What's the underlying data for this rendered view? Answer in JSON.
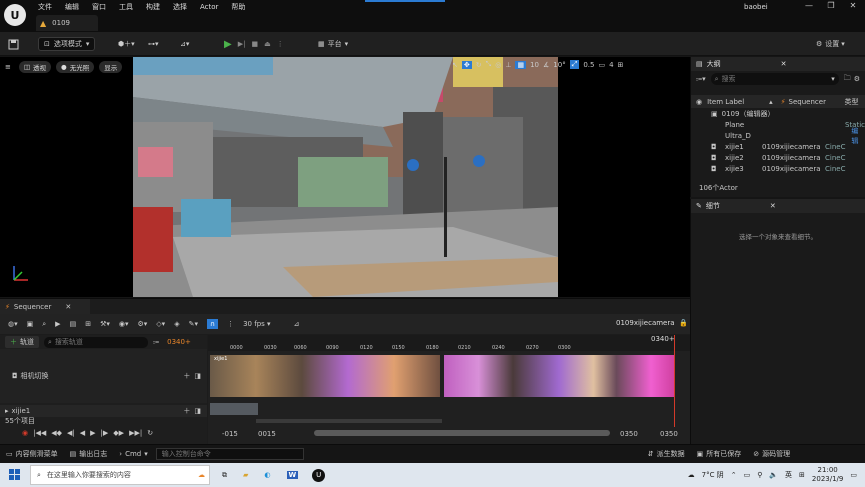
{
  "titlebar": {
    "menu": [
      "文件",
      "编辑",
      "窗口",
      "工具",
      "构建",
      "选择",
      "Actor",
      "帮助"
    ],
    "project_tab": "0109",
    "user": "baobei",
    "buttons": [
      "minimize",
      "maximize",
      "close"
    ]
  },
  "toolbar": {
    "mode": "选项模式",
    "platform": "平台",
    "settings": "设置"
  },
  "viewport": {
    "perspective": "透视",
    "lighting": "无光照",
    "show": "显示",
    "grid_snap": "10",
    "rotation_snap": "10°",
    "scale_snap": "0.5",
    "camera_speed": "4"
  },
  "outliner": {
    "title": "大纲",
    "search_placeholder": "搜索",
    "col_label": "Item Label",
    "col_sequencer": "Sequencer",
    "col_type": "类型",
    "root": "0109（编辑器）",
    "rows": [
      {
        "name": "Plane",
        "seq": "",
        "type": "Static"
      },
      {
        "name": "Ultra_D",
        "seq": "",
        "type": "编辑"
      },
      {
        "name": "xijie1",
        "seq": "0109xijiecamera",
        "type": "CineC"
      },
      {
        "name": "xijie2",
        "seq": "0109xijiecamera",
        "type": "CineC"
      },
      {
        "name": "xijie3",
        "seq": "0109xijiecamera",
        "type": "CineC"
      }
    ],
    "count": "106个Actor"
  },
  "details": {
    "title": "细节",
    "hint": "选择一个对象来查看细节。"
  },
  "sequencer": {
    "title": "Sequencer",
    "fps": "30 fps",
    "sequence_name": "0109xijiecamera",
    "add_track": "轨道",
    "search_placeholder": "搜索轨道",
    "current_frame": "0340+",
    "ruler": [
      "0000",
      "0030",
      "0060",
      "0090",
      "0120",
      "0150",
      "0180",
      "0210",
      "0240",
      "0270",
      "0300"
    ],
    "camera_track": "相机切换",
    "shot_track": "xijie1",
    "items_count": "55个项目",
    "range_start_outer": "-015",
    "range_start": "0015",
    "range_end": "0350",
    "range_end_outer": "0350",
    "shot_clip_label": "xijie1"
  },
  "statusbar": {
    "content_drawer": "内容侧滑菜单",
    "output_log": "输出日志",
    "cmd": "Cmd",
    "console_placeholder": "输入控制台命令",
    "derived_data": "派生数据",
    "all_saved": "所有已保存",
    "source_control": "源码管理"
  },
  "taskbar": {
    "search_placeholder": "在这里输入你要搜索的内容",
    "weather": "7°C 阴",
    "ime": "英",
    "time": "21:00",
    "date": "2023/1/9"
  },
  "colors": {
    "accent_blue": "#2b7bd3",
    "play_green": "#4bb34b",
    "frame_orange": "#e8852a",
    "playhead_red": "#d33a2a"
  }
}
